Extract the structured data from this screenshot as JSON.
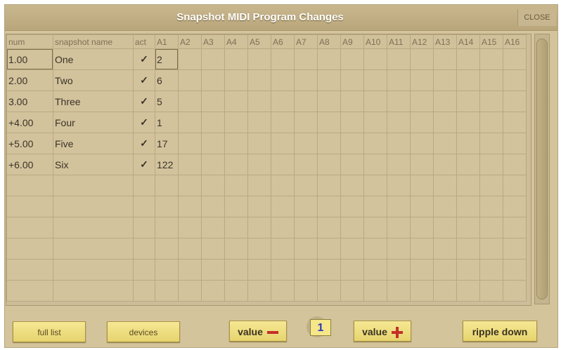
{
  "window": {
    "title": "Snapshot MIDI Program Changes",
    "close_label": "CLOSE"
  },
  "table": {
    "headers": [
      "num",
      "snapshot name",
      "act",
      "A1",
      "A2",
      "A3",
      "A4",
      "A5",
      "A6",
      "A7",
      "A8",
      "A9",
      "A10",
      "A11",
      "A12",
      "A13",
      "A14",
      "A15",
      "A16"
    ],
    "rows": [
      {
        "num": "1.00",
        "name": "One",
        "act": "✓",
        "a1": "2",
        "style": "green",
        "selected": true
      },
      {
        "num": "2.00",
        "name": "Two",
        "act": "✓",
        "a1": "6",
        "style": "normal"
      },
      {
        "num": "3.00",
        "name": "Three",
        "act": "✓",
        "a1": "5",
        "style": "normal"
      },
      {
        "num": "+4.00",
        "name": "Four",
        "act": "✓",
        "a1": "1",
        "style": "red"
      },
      {
        "num": "+5.00",
        "name": "Five",
        "act": "✓",
        "a1": "17",
        "style": "red"
      },
      {
        "num": "+6.00",
        "name": "Six",
        "act": "✓",
        "a1": "122",
        "style": "red"
      }
    ],
    "empty_rows": 6
  },
  "toolbar": {
    "full_list": "full list",
    "devices": "devices",
    "value_minus": "value",
    "value_plus": "value",
    "current_value": "1",
    "ripple_down": "ripple down"
  },
  "colors": {
    "panel": "#d4c49c",
    "button": "#f0e080",
    "check": "#1d5a2a",
    "green_text": "#2f8a3a",
    "red_text": "#e0504a"
  }
}
